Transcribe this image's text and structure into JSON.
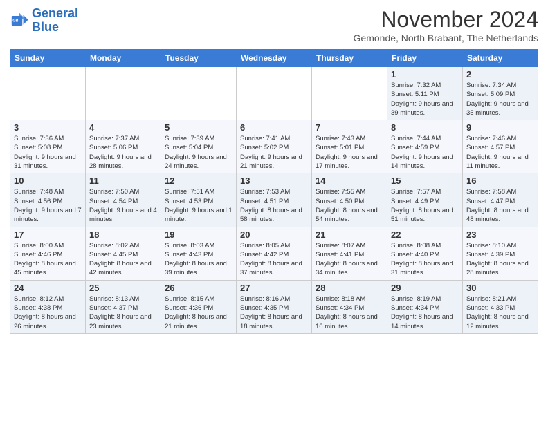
{
  "header": {
    "logo_line1": "General",
    "logo_line2": "Blue",
    "month_title": "November 2024",
    "location": "Gemonde, North Brabant, The Netherlands"
  },
  "days_of_week": [
    "Sunday",
    "Monday",
    "Tuesday",
    "Wednesday",
    "Thursday",
    "Friday",
    "Saturday"
  ],
  "weeks": [
    [
      {
        "day": "",
        "info": ""
      },
      {
        "day": "",
        "info": ""
      },
      {
        "day": "",
        "info": ""
      },
      {
        "day": "",
        "info": ""
      },
      {
        "day": "",
        "info": ""
      },
      {
        "day": "1",
        "info": "Sunrise: 7:32 AM\nSunset: 5:11 PM\nDaylight: 9 hours and 39 minutes."
      },
      {
        "day": "2",
        "info": "Sunrise: 7:34 AM\nSunset: 5:09 PM\nDaylight: 9 hours and 35 minutes."
      }
    ],
    [
      {
        "day": "3",
        "info": "Sunrise: 7:36 AM\nSunset: 5:08 PM\nDaylight: 9 hours and 31 minutes."
      },
      {
        "day": "4",
        "info": "Sunrise: 7:37 AM\nSunset: 5:06 PM\nDaylight: 9 hours and 28 minutes."
      },
      {
        "day": "5",
        "info": "Sunrise: 7:39 AM\nSunset: 5:04 PM\nDaylight: 9 hours and 24 minutes."
      },
      {
        "day": "6",
        "info": "Sunrise: 7:41 AM\nSunset: 5:02 PM\nDaylight: 9 hours and 21 minutes."
      },
      {
        "day": "7",
        "info": "Sunrise: 7:43 AM\nSunset: 5:01 PM\nDaylight: 9 hours and 17 minutes."
      },
      {
        "day": "8",
        "info": "Sunrise: 7:44 AM\nSunset: 4:59 PM\nDaylight: 9 hours and 14 minutes."
      },
      {
        "day": "9",
        "info": "Sunrise: 7:46 AM\nSunset: 4:57 PM\nDaylight: 9 hours and 11 minutes."
      }
    ],
    [
      {
        "day": "10",
        "info": "Sunrise: 7:48 AM\nSunset: 4:56 PM\nDaylight: 9 hours and 7 minutes."
      },
      {
        "day": "11",
        "info": "Sunrise: 7:50 AM\nSunset: 4:54 PM\nDaylight: 9 hours and 4 minutes."
      },
      {
        "day": "12",
        "info": "Sunrise: 7:51 AM\nSunset: 4:53 PM\nDaylight: 9 hours and 1 minute."
      },
      {
        "day": "13",
        "info": "Sunrise: 7:53 AM\nSunset: 4:51 PM\nDaylight: 8 hours and 58 minutes."
      },
      {
        "day": "14",
        "info": "Sunrise: 7:55 AM\nSunset: 4:50 PM\nDaylight: 8 hours and 54 minutes."
      },
      {
        "day": "15",
        "info": "Sunrise: 7:57 AM\nSunset: 4:49 PM\nDaylight: 8 hours and 51 minutes."
      },
      {
        "day": "16",
        "info": "Sunrise: 7:58 AM\nSunset: 4:47 PM\nDaylight: 8 hours and 48 minutes."
      }
    ],
    [
      {
        "day": "17",
        "info": "Sunrise: 8:00 AM\nSunset: 4:46 PM\nDaylight: 8 hours and 45 minutes."
      },
      {
        "day": "18",
        "info": "Sunrise: 8:02 AM\nSunset: 4:45 PM\nDaylight: 8 hours and 42 minutes."
      },
      {
        "day": "19",
        "info": "Sunrise: 8:03 AM\nSunset: 4:43 PM\nDaylight: 8 hours and 39 minutes."
      },
      {
        "day": "20",
        "info": "Sunrise: 8:05 AM\nSunset: 4:42 PM\nDaylight: 8 hours and 37 minutes."
      },
      {
        "day": "21",
        "info": "Sunrise: 8:07 AM\nSunset: 4:41 PM\nDaylight: 8 hours and 34 minutes."
      },
      {
        "day": "22",
        "info": "Sunrise: 8:08 AM\nSunset: 4:40 PM\nDaylight: 8 hours and 31 minutes."
      },
      {
        "day": "23",
        "info": "Sunrise: 8:10 AM\nSunset: 4:39 PM\nDaylight: 8 hours and 28 minutes."
      }
    ],
    [
      {
        "day": "24",
        "info": "Sunrise: 8:12 AM\nSunset: 4:38 PM\nDaylight: 8 hours and 26 minutes."
      },
      {
        "day": "25",
        "info": "Sunrise: 8:13 AM\nSunset: 4:37 PM\nDaylight: 8 hours and 23 minutes."
      },
      {
        "day": "26",
        "info": "Sunrise: 8:15 AM\nSunset: 4:36 PM\nDaylight: 8 hours and 21 minutes."
      },
      {
        "day": "27",
        "info": "Sunrise: 8:16 AM\nSunset: 4:35 PM\nDaylight: 8 hours and 18 minutes."
      },
      {
        "day": "28",
        "info": "Sunrise: 8:18 AM\nSunset: 4:34 PM\nDaylight: 8 hours and 16 minutes."
      },
      {
        "day": "29",
        "info": "Sunrise: 8:19 AM\nSunset: 4:34 PM\nDaylight: 8 hours and 14 minutes."
      },
      {
        "day": "30",
        "info": "Sunrise: 8:21 AM\nSunset: 4:33 PM\nDaylight: 8 hours and 12 minutes."
      }
    ]
  ]
}
